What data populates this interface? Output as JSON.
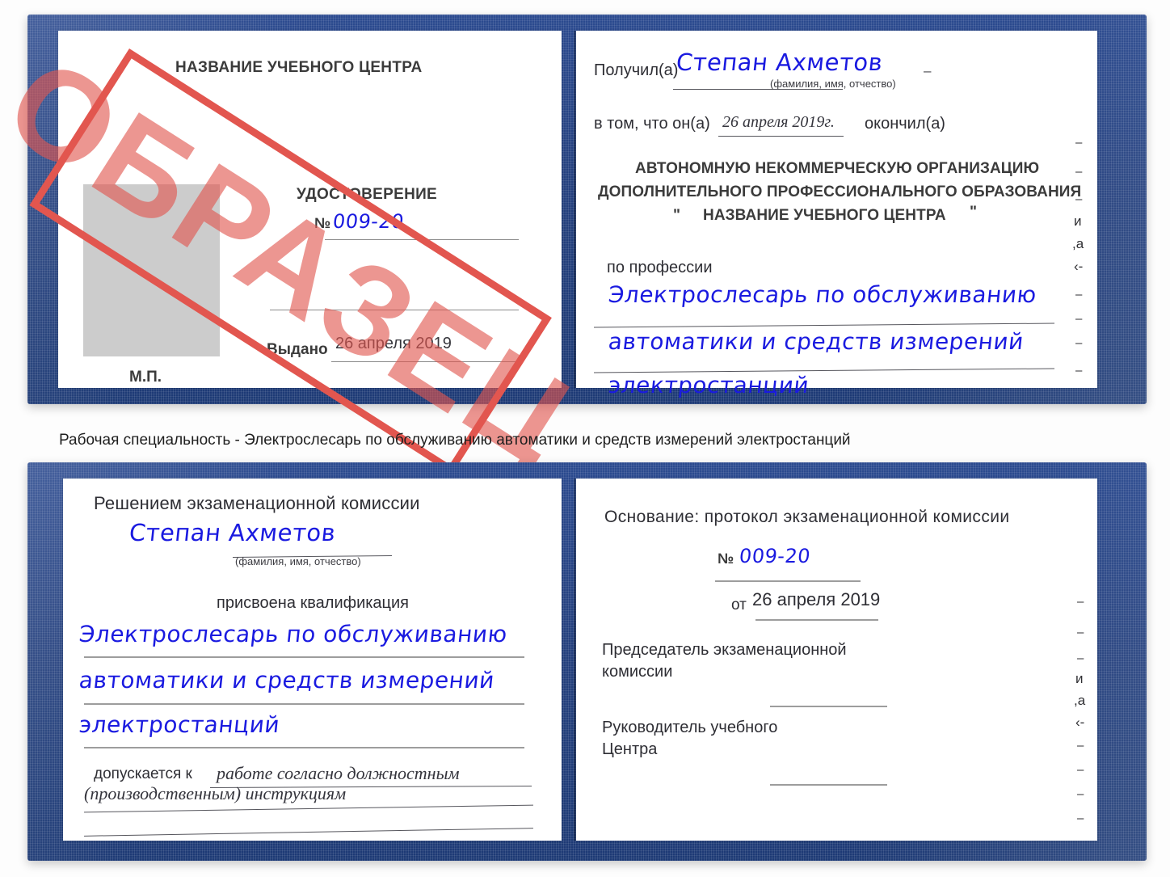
{
  "meta": {
    "caption": "Рабочая специальность - Электрослесарь по обслуживанию автоматики и средств измерений электростанций",
    "stamp_text": "ОБРАЗЕЦ",
    "accent_red": "#e2564f",
    "cover_blue": "#24407e",
    "ink_blue": "#1a1ae0"
  },
  "cert_top": {
    "left_page": {
      "org_title": "НАЗВАНИЕ УЧЕБНОГО ЦЕНТРА",
      "doc_type": "УДОСТОВЕРЕНИЕ",
      "number_label": "№",
      "number_value": "009-20",
      "issued_label": "Выдано",
      "issued_value": "26 апреля 2019",
      "seal_label": "М.П.",
      "photo_placeholder": "photo-area"
    },
    "right_page": {
      "received_label": "Получил(а)",
      "received_value": "Степан Ахметов",
      "fio_hint": "(фамилия, имя, отчество)",
      "in_that_label": "в том, что он(а)",
      "in_that_value": "26 апреля 2019г.",
      "finished_label": "окончил(а)",
      "org_line1": "АВТОНОМНУЮ НЕКОММЕРЧЕСКУЮ ОРГАНИЗАЦИЮ",
      "org_line2": "ДОПОЛНИТЕЛЬНОГО ПРОФЕССИОНАЛЬНОГО ОБРАЗОВАНИЯ",
      "org_quote_open": "\"",
      "org_line3": "НАЗВАНИЕ УЧЕБНОГО ЦЕНТРА",
      "org_quote_close": "\"",
      "profession_label": "по профессии",
      "profession_line1": "Электрослесарь по обслуживанию",
      "profession_line2": "автоматики и средств измерений",
      "profession_line3": "электростанций",
      "edge_marks": [
        "–",
        "–",
        "–",
        "и",
        "а",
        "‹-",
        "–",
        "–",
        "–",
        "–"
      ]
    }
  },
  "cert_bottom": {
    "left_page": {
      "decision_title": "Решением экзаменационной комиссии",
      "name_value": "Степан Ахметов",
      "fio_hint": "(фамилия, имя, отчество)",
      "qualification_label": "присвоена квалификация",
      "qual_line1": "Электрослесарь по обслуживанию",
      "qual_line2": "автоматики и средств измерений",
      "qual_line3": "электростанций",
      "admitted_label": "допускается к",
      "admitted_value1": "работе согласно должностным",
      "admitted_value2": "(производственным) инструкциям"
    },
    "right_page": {
      "basis_label": "Основание: протокол экзаменационной комиссии",
      "number_label": "№",
      "number_value": "009-20",
      "date_label": "от",
      "date_value": "26 апреля 2019",
      "chairman_line1": "Председатель экзаменационной",
      "chairman_line2": "комиссии",
      "head_line1": "Руководитель учебного",
      "head_line2": "Центра",
      "edge_marks": [
        "–",
        "–",
        "–",
        "и",
        "а",
        "‹-",
        "–",
        "–",
        "–",
        "–"
      ]
    }
  }
}
